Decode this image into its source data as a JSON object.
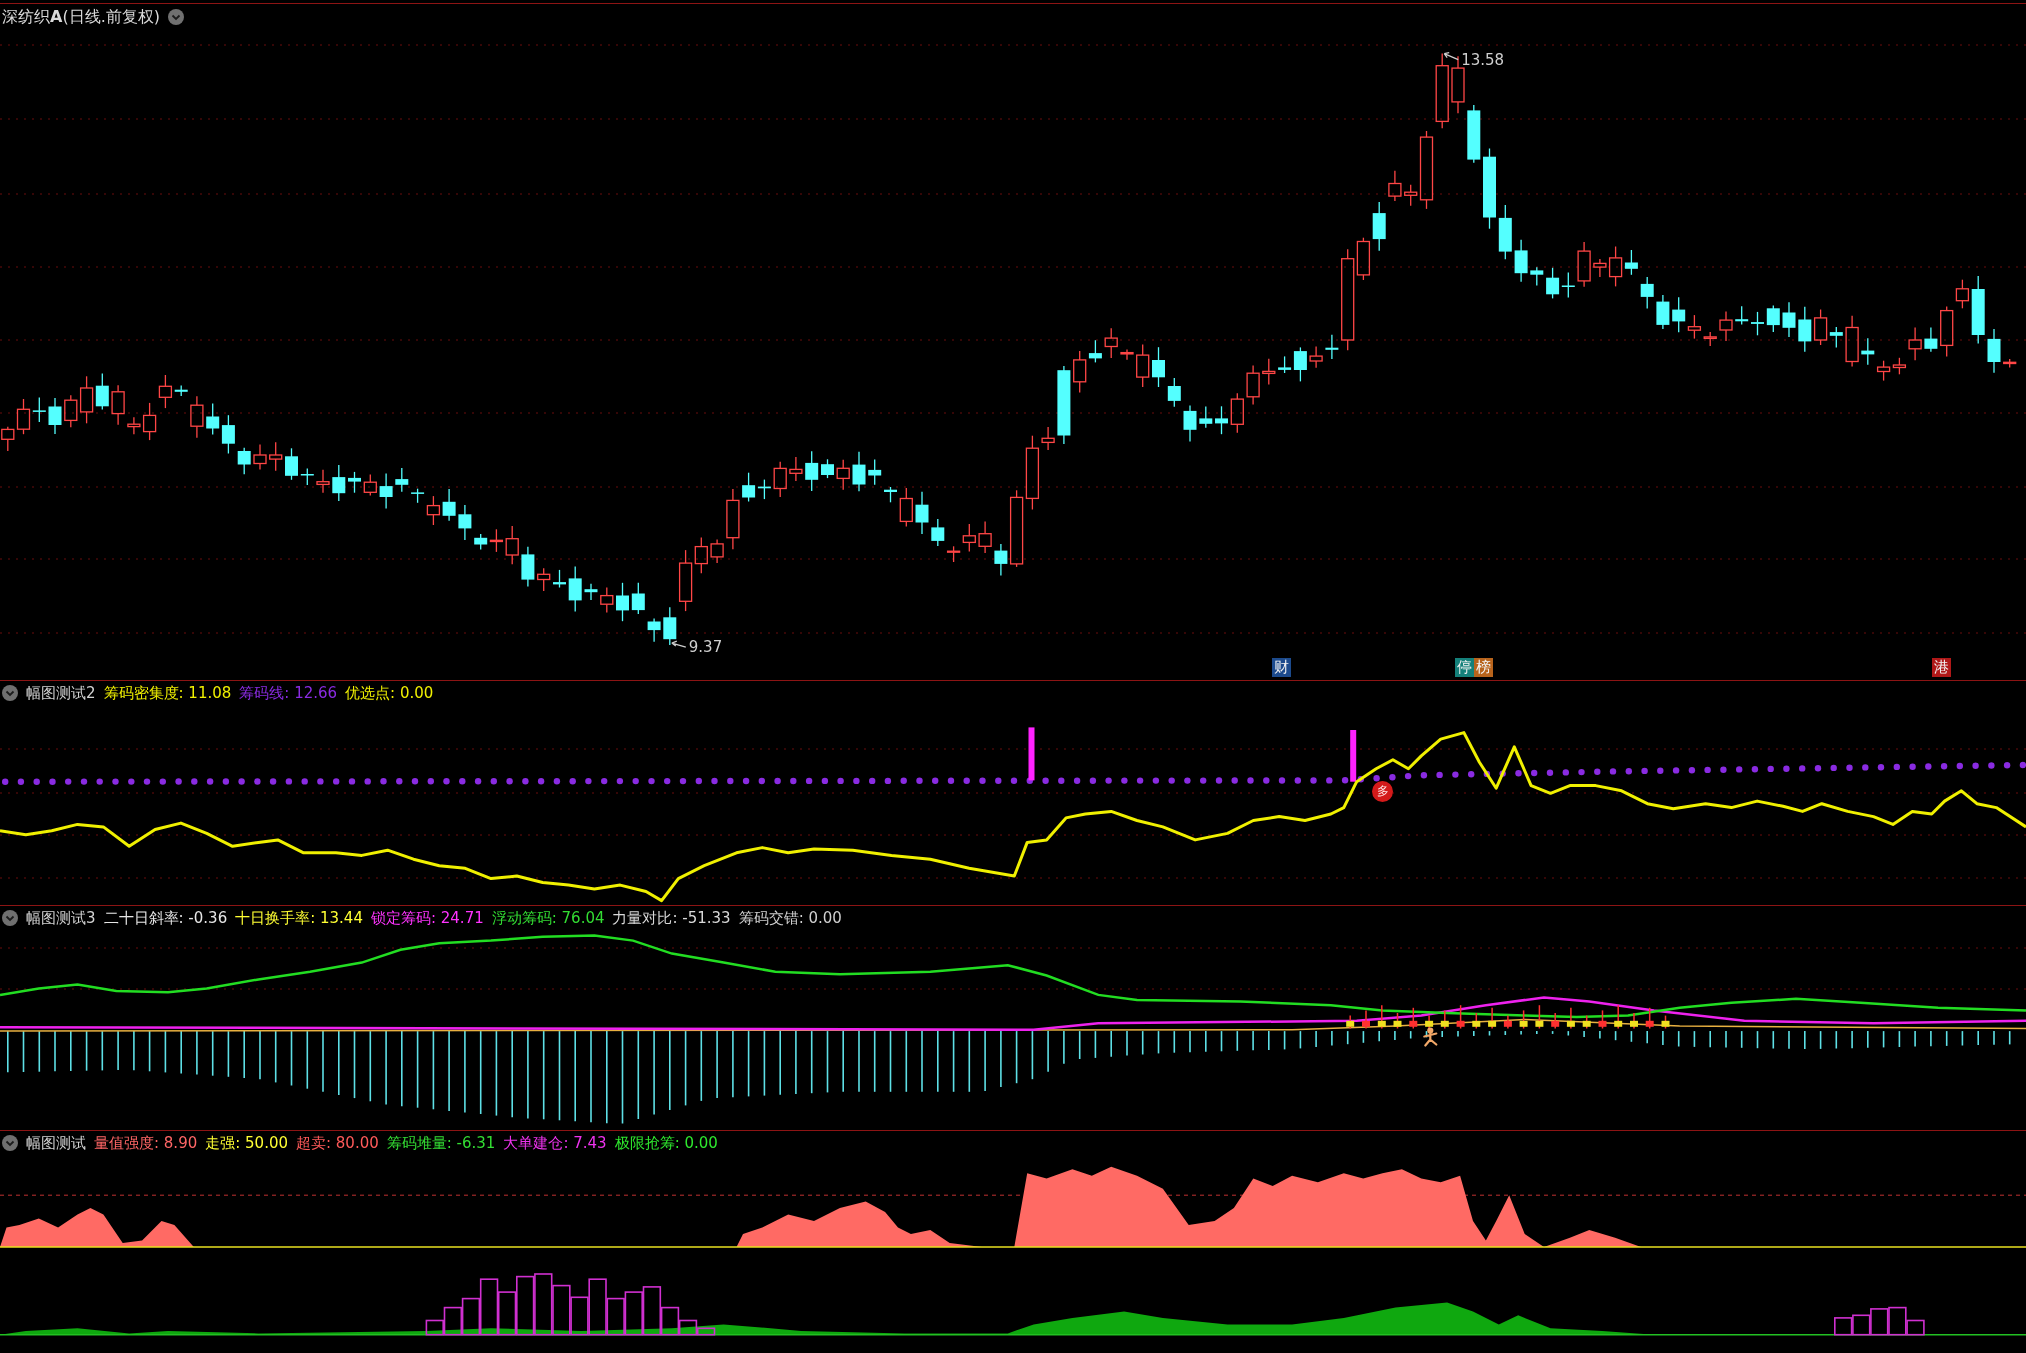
{
  "title": {
    "text": "深纺织**A**(日线.前复权)"
  },
  "main_chart": {
    "high_label": "13.58",
    "low_label": "9.37",
    "markers": [
      {
        "text": "财",
        "color": "#1c4a8c"
      },
      {
        "text": "停",
        "color": "#14807a"
      },
      {
        "text": "榜",
        "color": "#b8641c"
      },
      {
        "text": "港",
        "color": "#b01818"
      }
    ]
  },
  "panels": [
    {
      "kind": "chip_density",
      "name": "幅图测试2",
      "indicators": [
        {
          "text": "筹码密集度: 11.08",
          "color": "#f0f000"
        },
        {
          "text": "筹码线: 12.66",
          "color": "#8a2be2"
        },
        {
          "text": "优选点: 0.00",
          "color": "#f0f000"
        }
      ],
      "signal": "多"
    },
    {
      "kind": "chip_flow",
      "name": "幅图测试3",
      "indicators": [
        {
          "text": "二十日斜率: -0.36",
          "color": "#e6e6e6"
        },
        {
          "text": "十日换手率: 13.44",
          "color": "#ffff33"
        },
        {
          "text": "锁定筹码: 24.71",
          "color": "#ff33ff"
        },
        {
          "text": "浮动筹码: 76.04",
          "color": "#33dd33"
        },
        {
          "text": "力量对比: -51.33",
          "color": "#d8d8d8"
        },
        {
          "text": "筹码交错: 0.00",
          "color": "#d0d0d0"
        }
      ]
    },
    {
      "kind": "volume_strength",
      "name": "幅图测试",
      "indicators": [
        {
          "text": "量值强度: 8.90",
          "color": "#ff6666"
        },
        {
          "text": "走强: 50.00",
          "color": "#ffff33"
        },
        {
          "text": "超卖: 80.00",
          "color": "#ff5a5a"
        },
        {
          "text": "筹码堆量: -6.31",
          "color": "#33dd33"
        },
        {
          "text": "大单建仓: 7.43",
          "color": "#ee33ee"
        },
        {
          "text": "极限抢筹: 0.00",
          "color": "#2ee82e"
        }
      ]
    }
  ]
}
